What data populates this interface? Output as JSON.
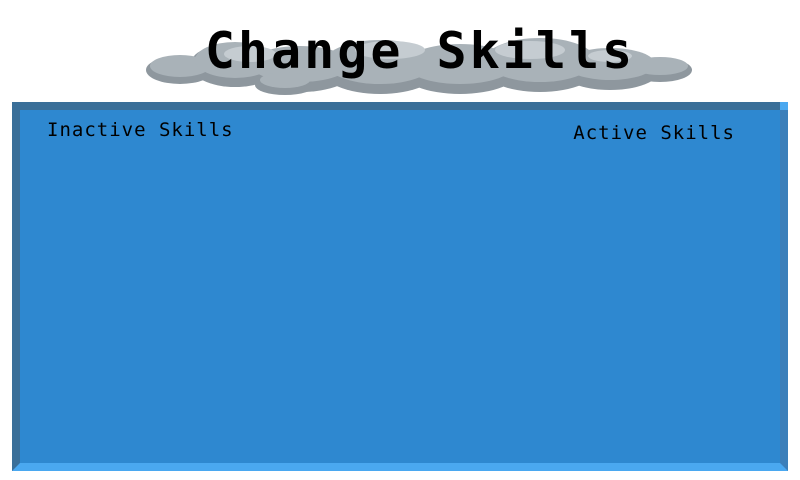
{
  "header": {
    "title": "Change Skills"
  },
  "panel": {
    "inactive_heading": "Inactive Skills",
    "active_heading": "Active Skills",
    "inactive_skills": [],
    "active_skills": []
  },
  "colors": {
    "panel_fill": "#2e88d0",
    "panel_border_dark": "#3a6f99",
    "panel_border_light": "#4aa8f0",
    "cloud_fill": "#a9b2b8",
    "cloud_shadow": "#8e979e"
  }
}
